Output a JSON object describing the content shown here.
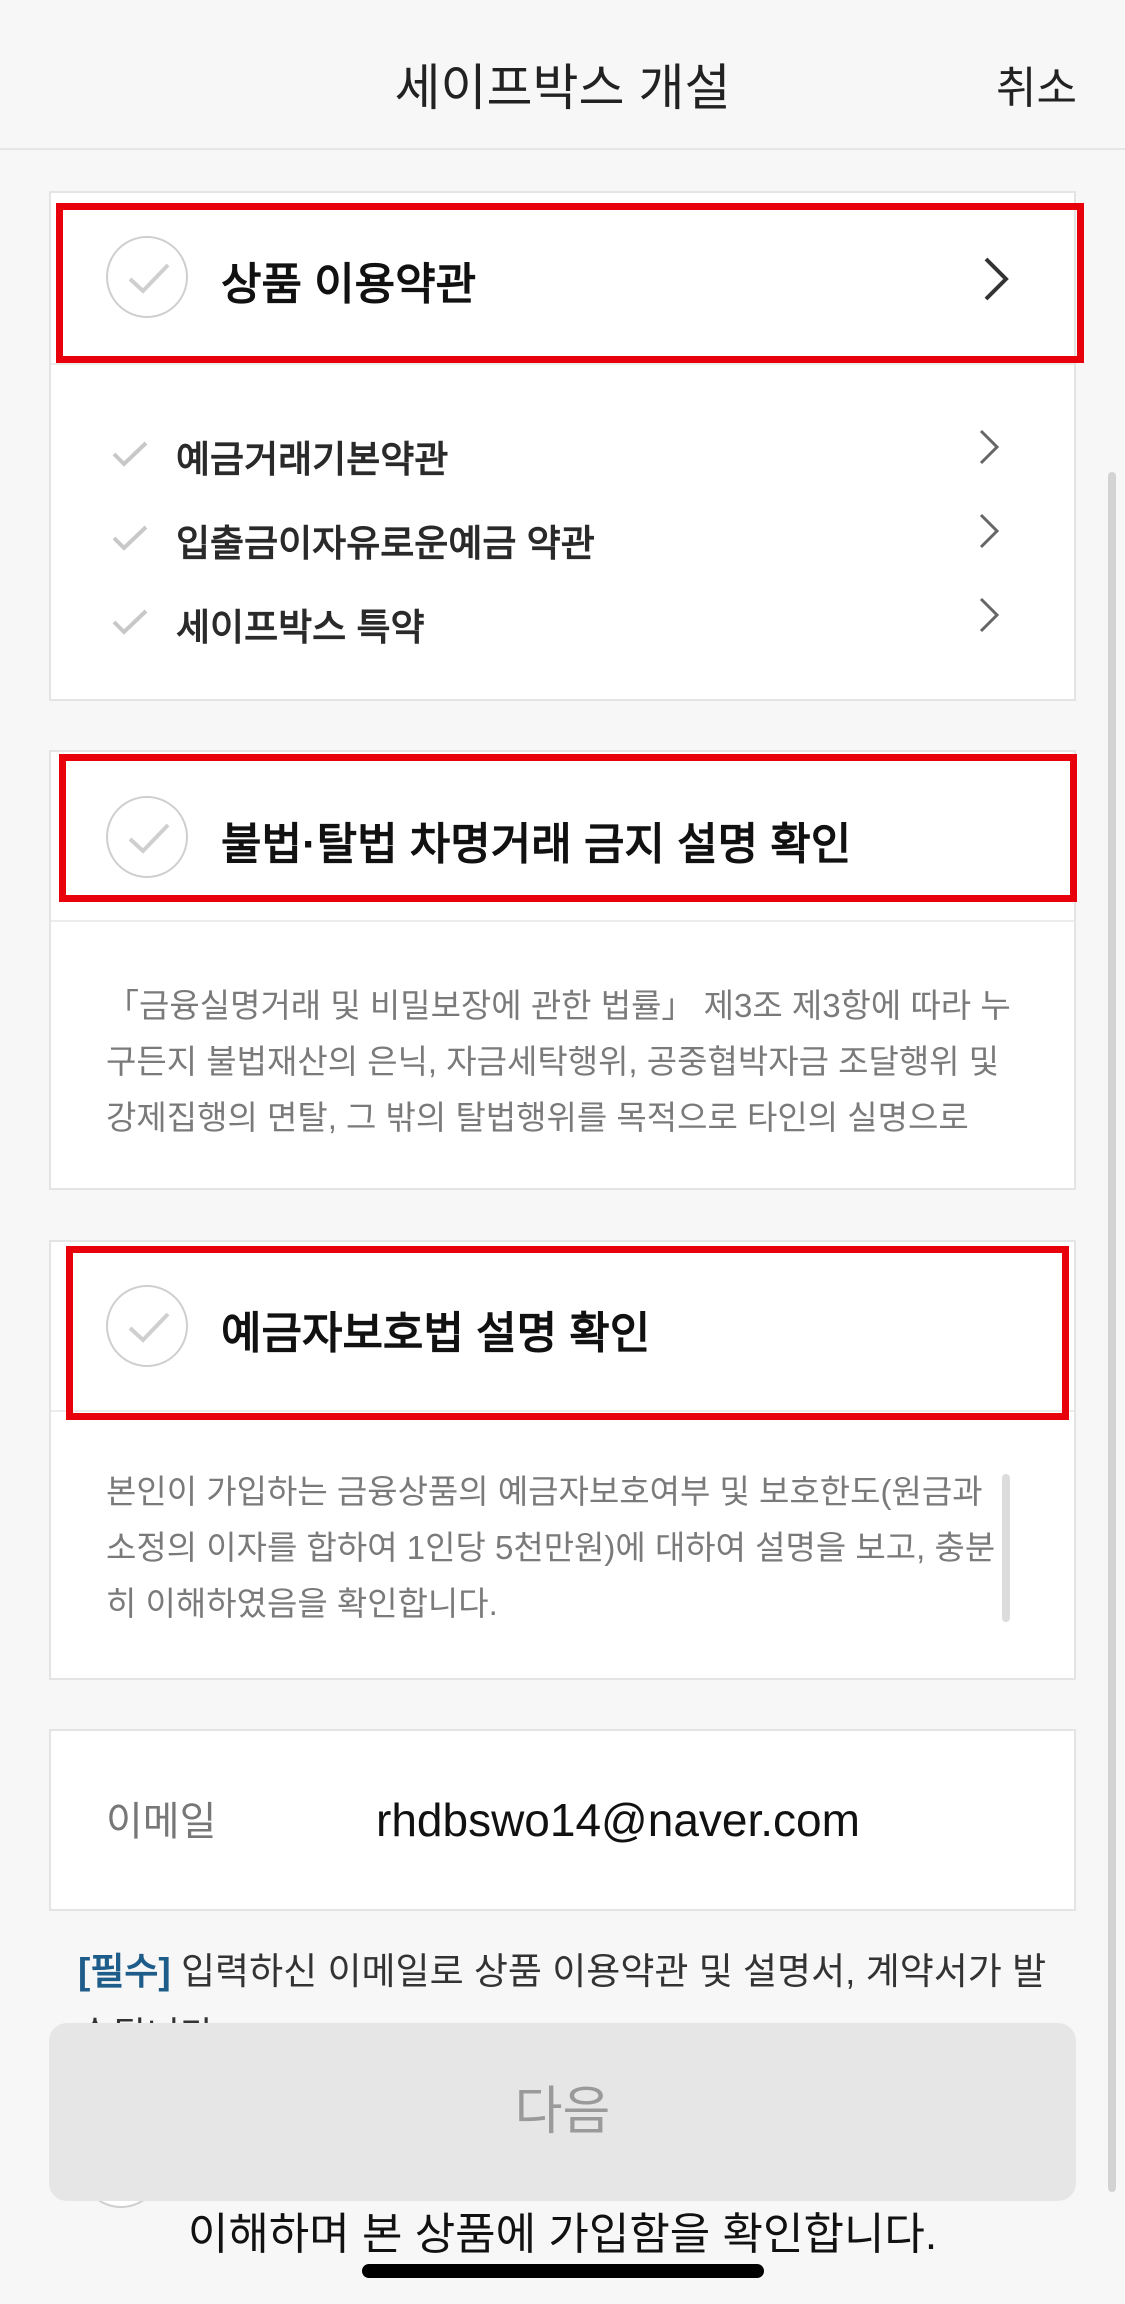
{
  "header": {
    "title": "세이프박스 개설",
    "cancel_label": "취소"
  },
  "terms": {
    "title": "상품 이용약관",
    "items": [
      {
        "label": "예금거래기본약관"
      },
      {
        "label": "입출금이자유로운예금 약관"
      },
      {
        "label": "세이프박스 특약"
      }
    ]
  },
  "illegal": {
    "title": "불법·탈법 차명거래 금지 설명 확인",
    "description": [
      "「금융실명거래 및 비밀보장에 관한 법률」 제3조 제3항에 따라 누",
      "구든지 불법재산의 은닉, 자금세탁행위, 공중협박자금 조달행위 및",
      "강제집행의 면탈, 그 밖의 탈법행위를 목적으로 타인의 실명으로"
    ]
  },
  "protection": {
    "title": "예금자보호법 설명 확인",
    "description": [
      "본인이 가입하는 금융상품의 예금자보호여부 및 보호한도(원금과",
      "소정의 이자를 합하여 1인당 5천만원)에 대하여 설명을 보고, 충분",
      "히 이해하였음을 확인합니다."
    ]
  },
  "email": {
    "label": "이메일",
    "value": "rhdbswo14@naver.com"
  },
  "notice": {
    "required_tag": "[필수]",
    "text": " 입력하신 이메일로 상품 이용약관 및 설명서, 계약서가 발송됩니다."
  },
  "next_label": "다음",
  "confirm_text": "이해하며 본 상품에 가입함을 확인합니다.",
  "colors": {
    "highlight": "#e8000b",
    "required": "#1e5c8a",
    "button_bg": "#e6e6e6"
  }
}
